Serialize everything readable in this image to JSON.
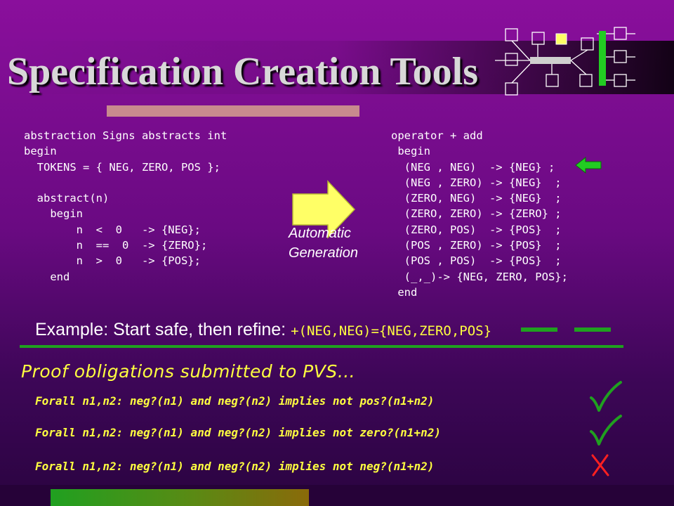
{
  "slide": {
    "title": "Specification Creation Tools",
    "abstraction_code": "abstraction Signs abstracts int\nbegin\n  TOKENS = { NEG, ZERO, POS };\n\n  abstract(n)\n    begin\n        n  <  0   -> {NEG};\n        n  ==  0  -> {ZERO};\n        n  >  0   -> {POS};\n    end",
    "operator_code": "operator + add\n begin\n  (NEG , NEG)  -> {NEG} ;\n  (NEG , ZERO) -> {NEG}  ;\n  (ZERO, NEG)  -> {NEG}  ;\n  (ZERO, ZERO) -> {ZERO} ;\n  (ZERO, POS)  -> {POS}  ;\n  (POS , ZERO) -> {POS}  ;\n  (POS , POS)  -> {POS}  ;\n  (_,_)-> {NEG, ZERO, POS};\n end",
    "arrow_label": "Automatic Generation",
    "example_text": "Example:  Start safe, then refine: ",
    "example_code": "+(NEG,NEG)={NEG,ZERO,POS}",
    "proof_heading": "Proof obligations submitted to PVS…",
    "obligations": [
      {
        "text": "Forall n1,n2: neg?(n1) and neg?(n2) implies not pos?(n1+n2)",
        "result": "check-icon"
      },
      {
        "text": "Forall n1,n2: neg?(n1) and neg?(n2) implies not zero?(n1+n2)",
        "result": "check-icon"
      },
      {
        "text": "Forall n1,n2: neg?(n1) and neg?(n2) implies not neg?(n1+n2)",
        "result": "x-icon"
      }
    ]
  },
  "colors": {
    "background_top": "#8a0f9c",
    "background_bottom": "#2a0440",
    "title_text": "#d8d8d8",
    "code_text": "#ffffff",
    "highlight_yellow": "#ffff40",
    "accent_green": "#20a020",
    "fail_red": "#ff2020",
    "arrow_yellow": "#ffff66",
    "title_rule": "#c88a8e"
  }
}
